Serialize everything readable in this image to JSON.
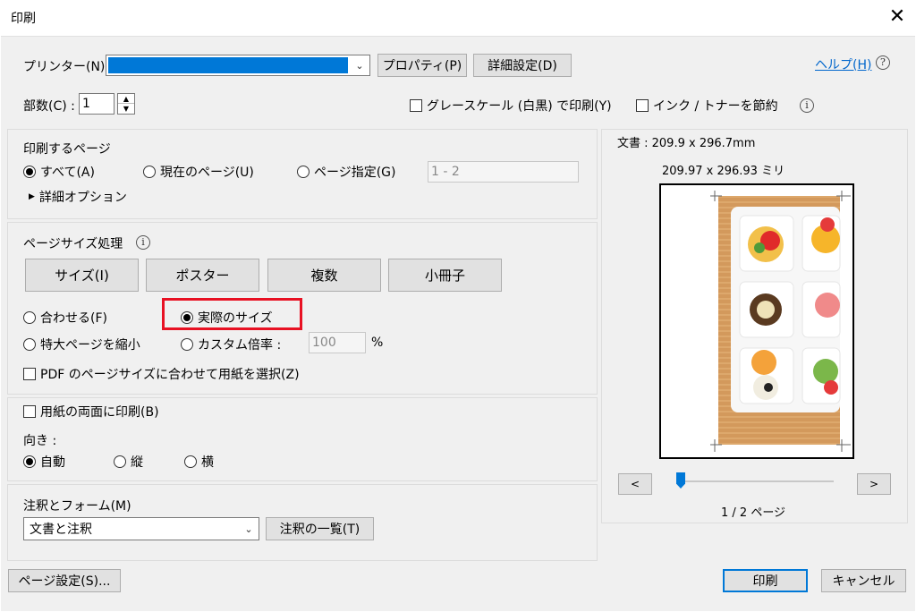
{
  "window": {
    "title": "印刷",
    "close_label": "✕"
  },
  "top": {
    "printer_label": "プリンター(N) :",
    "printer_value": "",
    "properties_button": "プロパティ(P)",
    "advanced_button": "詳細設定(D)",
    "help_link": "ヘルプ(H)",
    "copies_label": "部数(C) :",
    "copies_value": "1",
    "grayscale_label": "グレースケール (白黒) で印刷(Y)",
    "save_ink_label": "インク / トナーを節約"
  },
  "pages": {
    "heading": "印刷するページ",
    "all_label": "すべて(A)",
    "current_label": "現在のページ(U)",
    "specify_label": "ページ指定(G)",
    "range_value": "1 - 2",
    "more_options": "詳細オプション"
  },
  "sizing": {
    "heading": "ページサイズ処理",
    "buttons": [
      "サイズ(I)",
      "ポスター",
      "複数",
      "小冊子"
    ],
    "fit_label": "合わせる(F)",
    "actual_label": "実際のサイズ",
    "shrink_label": "特大ページを縮小",
    "custom_label": "カスタム倍率 :",
    "custom_value": "100",
    "percent": "%",
    "pdf_paper_label": "PDF のページサイズに合わせて用紙を選択(Z)"
  },
  "duplex": {
    "label": "用紙の両面に印刷(B)",
    "orientation_heading": "向き :",
    "auto_label": "自動",
    "portrait_label": "縦",
    "landscape_label": "横"
  },
  "comments": {
    "heading": "注釈とフォーム(M)",
    "select_value": "文書と注釈",
    "summary_button": "注釈の一覧(T)"
  },
  "preview": {
    "doc_size": "文書 : 209.9 x 296.7mm",
    "paper_size": "209.97 x 296.93 ミリ",
    "prev_label": "<",
    "next_label": ">",
    "page_indicator": "1 / 2 ページ",
    "slider_fraction": 0.0
  },
  "footer": {
    "page_setup": "ページ設定(S)...",
    "print": "印刷",
    "cancel": "キャンセル"
  },
  "colors": {
    "highlight": "#e81123",
    "printer_selection": "#0078d7",
    "accent": "#0078d7"
  }
}
